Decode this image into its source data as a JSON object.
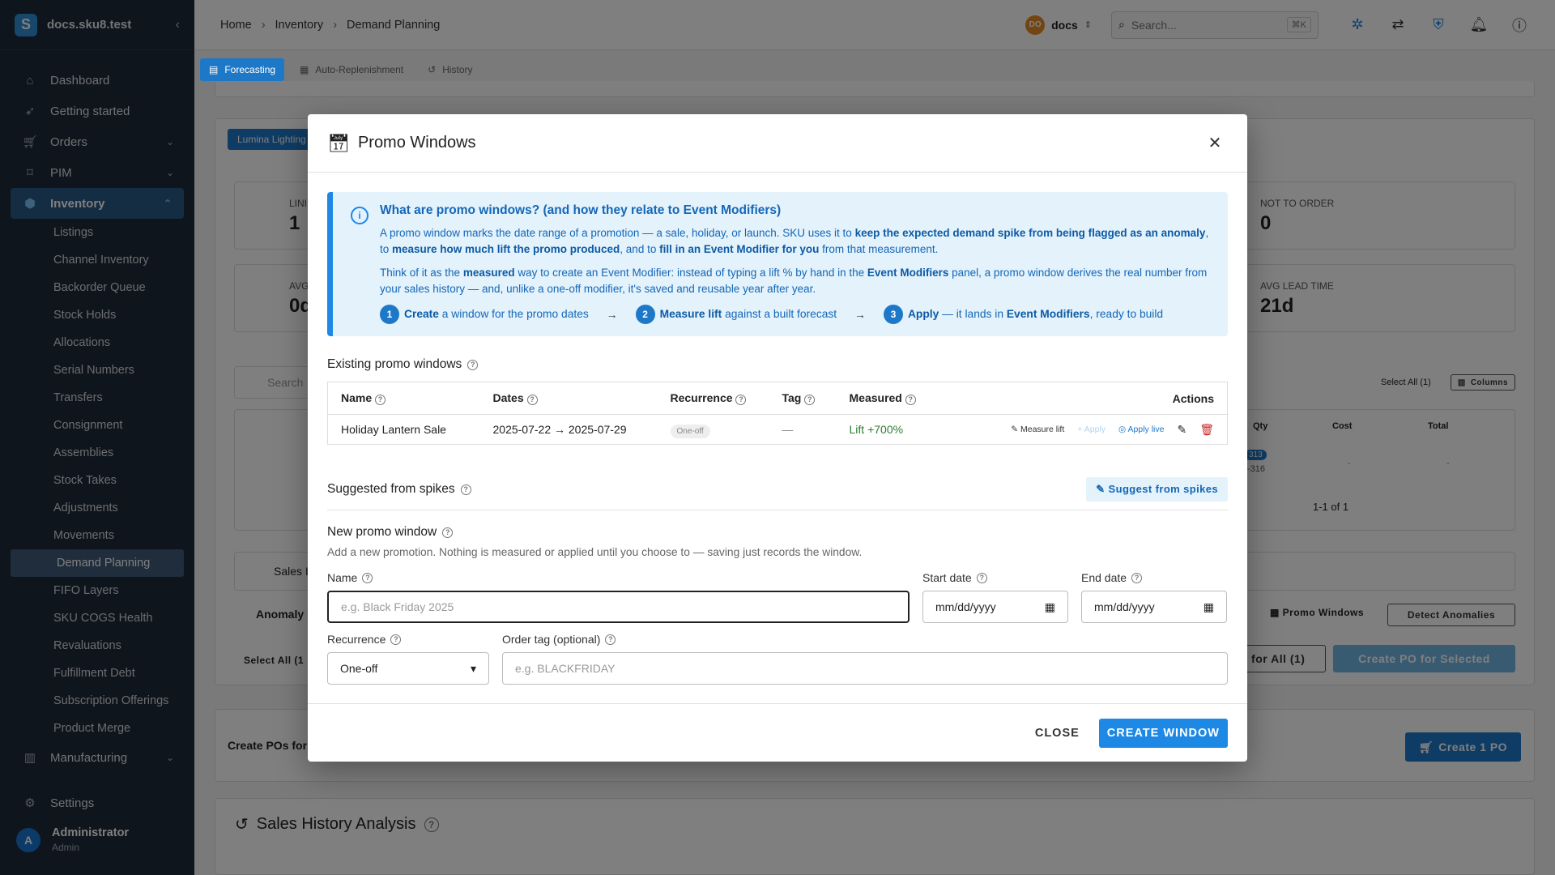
{
  "sidebar": {
    "org_name": "docs.sku8.test",
    "logo_letter": "S",
    "items": [
      {
        "label": "Dashboard",
        "icon": "home-icon"
      },
      {
        "label": "Getting started",
        "icon": "rocket-icon"
      },
      {
        "label": "Orders",
        "icon": "cart-icon"
      },
      {
        "label": "PIM",
        "icon": "tag-icon"
      },
      {
        "label": "Inventory",
        "icon": "cube-icon"
      }
    ],
    "inventory_sub": [
      "Listings",
      "Channel Inventory",
      "Backorder Queue",
      "Stock Holds",
      "Allocations",
      "Serial Numbers",
      "Transfers",
      "Consignment",
      "Assemblies",
      "Stock Takes",
      "Adjustments",
      "Movements",
      "Demand Planning",
      "FIFO Layers",
      "SKU COGS Health",
      "Revaluations",
      "Fulfillment Debt",
      "Subscription Offerings",
      "Product Merge"
    ],
    "manufacturing": "Manufacturing",
    "settings": "Settings",
    "user": {
      "initial": "A",
      "name": "Administrator",
      "role": "Admin"
    }
  },
  "topbar": {
    "crumbs": [
      "Home",
      "Inventory",
      "Demand Planning"
    ],
    "org_initials": "DO",
    "org_name": "docs",
    "search_placeholder": "Search...",
    "shortcut": "⌘K"
  },
  "tabs": [
    "Forecasting",
    "Auto-Replenishment",
    "History"
  ],
  "background": {
    "chip": "Lumina Lighting",
    "card1_label": "LINI",
    "card1_val": "1",
    "card2_label": "AVG",
    "card2_val": "0d",
    "not_to_order_label": "NOT TO ORDER",
    "not_to_order_val": "0",
    "avg_lead_label": "AVG LEAD TIME",
    "avg_lead_val": "21d",
    "search_ph": "Search",
    "select_all": "Select All (1)",
    "columns": "Columns",
    "col_qty": "Qty",
    "col_cost": "Cost",
    "col_total": "Total",
    "qty_badge": "313",
    "qty_sub": "-316",
    "dash": "-",
    "pager": "1-1 of 1",
    "sales_label": "Sales I",
    "anomaly_label": "Anomaly I",
    "promo_windows_btn": "Promo Windows",
    "detect_btn": "Detect Anomalies",
    "select_all2": "Select All (1",
    "for_all_btn": ") for All (1)",
    "create_po_sel": "Create PO for Selected",
    "create_pos_label": "Create POs for",
    "create_1po": "Create 1 PO",
    "sales_history": "Sales History Analysis"
  },
  "modal": {
    "title": "Promo Windows",
    "info": {
      "title": "What are promo windows? (and how they relate to Event Modifiers)",
      "p1_a": "A promo window marks the date range of a promotion — a sale, holiday, or launch. SKU uses it to ",
      "p1_b": "keep the expected demand spike from being flagged as an anomaly",
      "p1_c": ", to ",
      "p1_d": "measure how much lift the promo produced",
      "p1_e": ", and to ",
      "p1_f": "fill in an Event Modifier for you",
      "p1_g": " from that measurement.",
      "p2_a": "Think of it as the ",
      "p2_b": "measured",
      "p2_c": " way to create an Event Modifier: instead of typing a lift % by hand in the ",
      "p2_d": "Event Modifiers",
      "p2_e": " panel, a promo window derives the real number from your sales history — and, unlike a one-off modifier, it's saved and reusable year after year.",
      "step1_n": "1",
      "step1_b": "Create",
      "step1_t": " a window for the promo dates",
      "step2_n": "2",
      "step2_b": "Measure lift",
      "step2_t": " against a built forecast",
      "step3_n": "3",
      "step3_b": "Apply",
      "step3_t": " — it lands in ",
      "step3_b2": "Event Modifiers",
      "step3_t2": ", ready to build"
    },
    "existing_title": "Existing promo windows",
    "columns": [
      "Name",
      "Dates",
      "Recurrence",
      "Tag",
      "Measured",
      "Actions"
    ],
    "row": {
      "name": "Holiday Lantern Sale",
      "dates": "2025-07-22 → 2025-07-29",
      "recurrence": "One-off",
      "tag": "—",
      "measured": "Lift +700%",
      "measure_lift": "Measure lift",
      "apply": "Apply",
      "apply_live": "Apply live"
    },
    "suggested_title": "Suggested from spikes",
    "suggest_btn": "Suggest from spikes",
    "new_title": "New promo window",
    "new_hint": "Add a new promotion. Nothing is measured or applied until you choose to — saving just records the window.",
    "form": {
      "name_label": "Name",
      "name_placeholder": "e.g. Black Friday 2025",
      "start_label": "Start date",
      "start_value": "mm/dd/yyyy",
      "end_label": "End date",
      "end_value": "mm/dd/yyyy",
      "recurrence_label": "Recurrence",
      "recurrence_value": "One-off",
      "tag_label": "Order tag (optional)",
      "tag_placeholder": "e.g. BLACKFRIDAY"
    },
    "close_btn": "CLOSE",
    "create_btn": "CREATE WINDOW"
  }
}
